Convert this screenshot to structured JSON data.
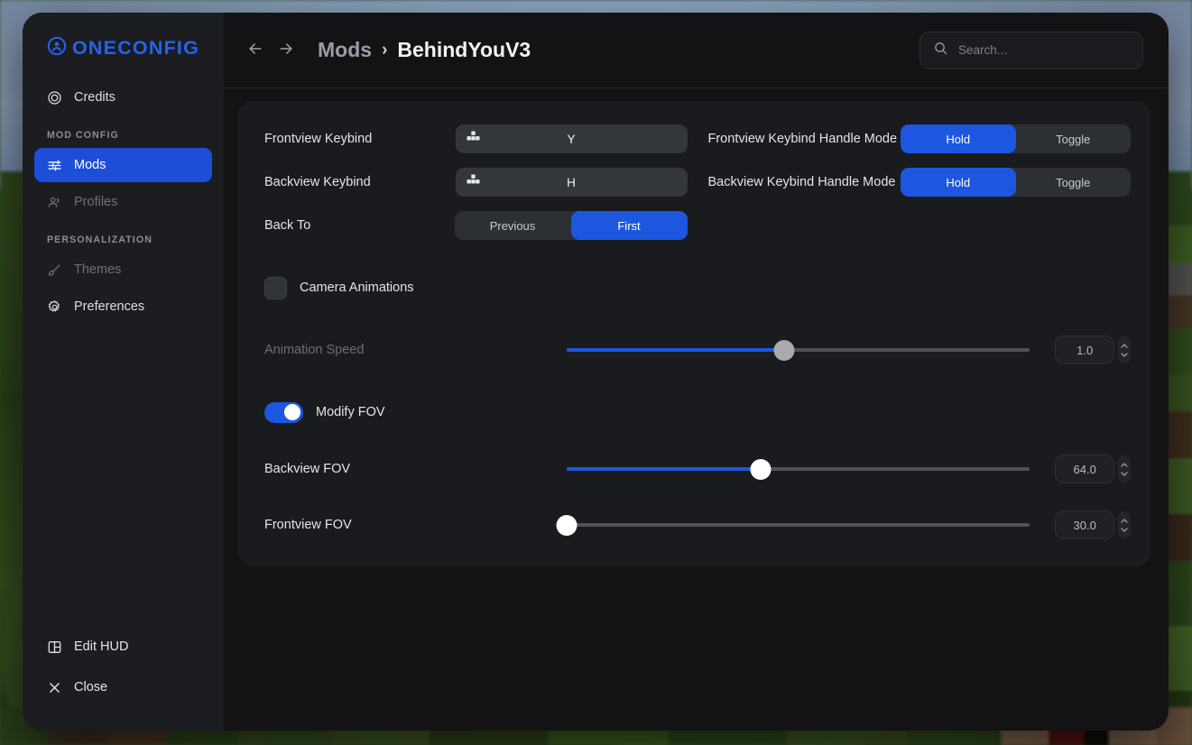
{
  "window": {
    "brand": "ONECONFIG",
    "brand_icon": "user-circle-logo-icon",
    "accent_color": "#1d57e0",
    "brand_color": "#2563eb"
  },
  "sidebar": {
    "top_items": [
      {
        "id": "credits",
        "label": "Credits",
        "icon": "copyright-circle-icon",
        "active": false,
        "dim": false
      }
    ],
    "sections": [
      {
        "label": "MOD CONFIG",
        "items": [
          {
            "id": "mods",
            "label": "Mods",
            "icon": "sliders-icon",
            "active": true,
            "dim": false
          },
          {
            "id": "profiles",
            "label": "Profiles",
            "icon": "users-icon",
            "active": false,
            "dim": true
          }
        ]
      },
      {
        "label": "PERSONALIZATION",
        "items": [
          {
            "id": "themes",
            "label": "Themes",
            "icon": "paintbrush-icon",
            "active": false,
            "dim": true
          },
          {
            "id": "preferences",
            "label": "Preferences",
            "icon": "gear-icon",
            "active": false,
            "dim": false
          }
        ]
      }
    ],
    "bottom_items": [
      {
        "id": "edit-hud",
        "label": "Edit HUD",
        "icon": "layout-panel-icon"
      },
      {
        "id": "close",
        "label": "Close",
        "icon": "close-x-icon"
      }
    ]
  },
  "topbar": {
    "back_icon": "arrow-left-icon",
    "forward_icon": "arrow-right-icon",
    "breadcrumb": {
      "parent": "Mods",
      "separator": "›",
      "current": "BehindYouV3"
    },
    "search": {
      "icon": "search-icon",
      "placeholder": "Search...",
      "value": ""
    }
  },
  "settings": {
    "frontview_keybind": {
      "label": "Frontview Keybind",
      "icon": "keyboard-keys-icon",
      "value": "Y"
    },
    "backview_keybind": {
      "label": "Backview Keybind",
      "icon": "keyboard-keys-icon",
      "value": "H"
    },
    "back_to": {
      "label": "Back To",
      "options": [
        "Previous",
        "First"
      ],
      "selected": "First"
    },
    "frontview_handle_mode": {
      "label": "Frontview Keybind Handle Mode",
      "options": [
        "Hold",
        "Toggle"
      ],
      "selected": "Hold"
    },
    "backview_handle_mode": {
      "label": "Backview Keybind Handle Mode",
      "options": [
        "Hold",
        "Toggle"
      ],
      "selected": "Hold"
    },
    "camera_animations": {
      "label": "Camera Animations",
      "checked": false
    },
    "animation_speed": {
      "label": "Animation Speed",
      "value": "1.0",
      "percent": 47,
      "disabled": true
    },
    "modify_fov": {
      "label": "Modify FOV",
      "enabled": true
    },
    "backview_fov": {
      "label": "Backview FOV",
      "value": "64.0",
      "percent": 42,
      "disabled": false
    },
    "frontview_fov": {
      "label": "Frontview FOV",
      "value": "30.0",
      "percent": 0,
      "disabled": false
    }
  }
}
